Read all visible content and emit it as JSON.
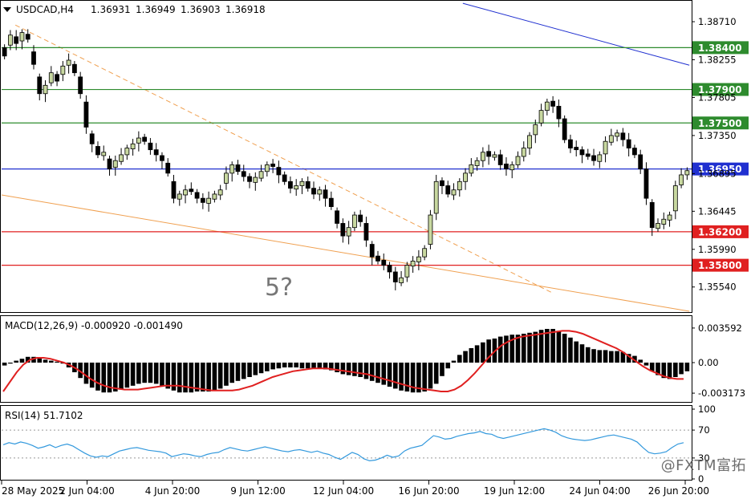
{
  "header": {
    "symbol_timeframe": "USDCAD,H4",
    "open": "1.36931",
    "high": "1.36949",
    "low": "1.36903",
    "close": "1.36918"
  },
  "annotation": "5?",
  "watermark": "@FXTM富拓",
  "colors": {
    "bull_body": "#c8d8a0",
    "bear_body": "#000000",
    "wick": "#000000",
    "resistance": "#2e8b2e",
    "support": "#e02020",
    "current": "#2030d0",
    "trend_blue": "#2030d0",
    "trend_orange": "#f0a050",
    "macd_hist": "#000000",
    "macd_signal": "#e02020",
    "rsi_line": "#3399dd"
  },
  "chart_data": [
    {
      "type": "candlestick",
      "panel": "price",
      "x_tick_labels": [
        "28 May 2025",
        "2 Jun 04:00",
        "4 Jun 20:00",
        "9 Jun 12:00",
        "12 Jun 04:00",
        "16 Jun 20:00",
        "19 Jun 12:00",
        "24 Jun 04:00",
        "26 Jun 20:00"
      ],
      "y_ticks": [
        "1.38710",
        "1.38255",
        "1.37805",
        "1.37350",
        "1.36895",
        "1.36445",
        "1.35990",
        "1.35540"
      ],
      "ylim": [
        1.3525,
        1.3895
      ],
      "levels": [
        {
          "label": "1.38400",
          "value": 1.384,
          "kind": "resistance"
        },
        {
          "label": "1.37900",
          "value": 1.379,
          "kind": "resistance"
        },
        {
          "label": "1.37500",
          "value": 1.375,
          "kind": "resistance"
        },
        {
          "label": "1.36950",
          "value": 1.3695,
          "kind": "current"
        },
        {
          "label": "1.36200",
          "value": 1.362,
          "kind": "support"
        },
        {
          "label": "1.35800",
          "value": 1.358,
          "kind": "support"
        }
      ],
      "trendlines": [
        {
          "color": "trend_blue",
          "style": "solid",
          "from": [
            0.67,
            1.3893
          ],
          "to": [
            0.999,
            1.3819
          ]
        },
        {
          "color": "trend_orange",
          "style": "dashed",
          "from": [
            0.02,
            1.3867
          ],
          "to": [
            0.8,
            1.3547
          ]
        },
        {
          "color": "trend_orange",
          "style": "solid",
          "from": [
            0.0,
            1.3664
          ],
          "to": [
            0.999,
            1.3525
          ]
        }
      ],
      "candles_close": [
        1.383,
        1.3855,
        1.3845,
        1.3858,
        1.385,
        1.382,
        1.3785,
        1.3795,
        1.381,
        1.38,
        1.3818,
        1.3825,
        1.381,
        1.3785,
        1.3745,
        1.3725,
        1.3712,
        1.3715,
        1.3695,
        1.3705,
        1.3712,
        1.372,
        1.3725,
        1.3732,
        1.3728,
        1.3718,
        1.3712,
        1.3705,
        1.369,
        1.366,
        1.3665,
        1.367,
        1.3668,
        1.366,
        1.3655,
        1.366,
        1.3665,
        1.367,
        1.369,
        1.37,
        1.3692,
        1.3686,
        1.368,
        1.3685,
        1.3692,
        1.37,
        1.3698,
        1.3688,
        1.368,
        1.3672,
        1.3675,
        1.368,
        1.3672,
        1.3665,
        1.367,
        1.366,
        1.365,
        1.363,
        1.3615,
        1.3625,
        1.364,
        1.3632,
        1.361,
        1.359,
        1.3585,
        1.358,
        1.3572,
        1.356,
        1.3565,
        1.358,
        1.3585,
        1.359,
        1.36,
        1.364,
        1.368,
        1.3675,
        1.3665,
        1.367,
        1.368,
        1.369,
        1.37,
        1.3705,
        1.3715,
        1.371,
        1.3712,
        1.37,
        1.3695,
        1.37,
        1.371,
        1.372,
        1.3735,
        1.3748,
        1.3765,
        1.3775,
        1.377,
        1.3755,
        1.373,
        1.372,
        1.3718,
        1.3712,
        1.371,
        1.3705,
        1.3712,
        1.3728,
        1.3735,
        1.3738,
        1.373,
        1.372,
        1.3712,
        1.3695,
        1.366,
        1.3625,
        1.363,
        1.3635,
        1.364,
        1.3675,
        1.3688,
        1.3693
      ],
      "candles_open_offset": [
        -0.001,
        0.0012,
        -0.0008,
        0.001,
        -0.0006,
        -0.0015,
        -0.002,
        0.001,
        0.0012,
        -0.0008,
        0.001,
        0.0006,
        -0.001,
        -0.002,
        -0.003,
        -0.0012,
        -0.001,
        0.0004,
        -0.0012,
        0.0008,
        0.0008,
        0.0008,
        0.0006,
        0.0006,
        -0.0005,
        -0.0008,
        -0.0006,
        -0.0006,
        -0.0012,
        -0.002,
        0.0006,
        0.0006,
        -0.0003,
        -0.0007,
        -0.0005,
        0.0006,
        0.0006,
        0.0006,
        0.0012,
        0.001,
        -0.0008,
        -0.0006,
        -0.0006,
        0.0006,
        0.0008,
        0.0008,
        -0.0003,
        -0.0009,
        -0.0008,
        -0.0008,
        0.0004,
        0.0005,
        -0.0008,
        -0.0007,
        0.0005,
        -0.001,
        -0.001,
        -0.0015,
        -0.0015,
        0.001,
        0.0015,
        -0.0008,
        -0.002,
        -0.0015,
        -0.0006,
        -0.0006,
        -0.0008,
        -0.0012,
        0.0006,
        0.0014,
        0.0006,
        0.0006,
        0.001,
        0.0035,
        0.0038,
        -0.0006,
        -0.001,
        0.0006,
        0.001,
        0.001,
        0.001,
        0.0006,
        0.001,
        -0.0006,
        0.0003,
        -0.0012,
        -0.0006,
        0.0006,
        0.001,
        0.001,
        0.0015,
        0.0012,
        0.0015,
        0.001,
        -0.0006,
        -0.0015,
        -0.0025,
        -0.001,
        -0.0003,
        -0.0006,
        -0.0003,
        -0.0006,
        0.0008,
        0.0015,
        0.0008,
        0.0004,
        -0.0008,
        -0.001,
        -0.0008,
        -0.0017,
        -0.0035,
        -0.003,
        0.0006,
        0.0006,
        0.0006,
        0.003,
        0.0012,
        0.0005
      ]
    },
    {
      "type": "bar",
      "panel": "macd",
      "indicator_label": "MACD(12,26,9) -0.000920 -0.001490",
      "y_ticks": [
        "0.003592",
        "0.00",
        "-0.003173"
      ],
      "ylim": [
        -0.004,
        0.0045
      ],
      "histogram": [
        -0.0003,
        -0.0001,
        0.0002,
        0.0004,
        0.0006,
        0.0006,
        0.0005,
        0.0003,
        0.0002,
        0.0001,
        -0.0001,
        -0.0005,
        -0.001,
        -0.0016,
        -0.0022,
        -0.0026,
        -0.0029,
        -0.0031,
        -0.0031,
        -0.003,
        -0.0028,
        -0.0026,
        -0.0024,
        -0.0022,
        -0.0021,
        -0.0021,
        -0.0022,
        -0.0024,
        -0.0027,
        -0.0029,
        -0.0031,
        -0.0031,
        -0.0031,
        -0.003,
        -0.003,
        -0.003,
        -0.0029,
        -0.0027,
        -0.0024,
        -0.0021,
        -0.0019,
        -0.0017,
        -0.0015,
        -0.0013,
        -0.0011,
        -0.0009,
        -0.0007,
        -0.0006,
        -0.0005,
        -0.0005,
        -0.0005,
        -0.0006,
        -0.0006,
        -0.0006,
        -0.0006,
        -0.0007,
        -0.0008,
        -0.001,
        -0.0012,
        -0.0013,
        -0.0014,
        -0.0015,
        -0.0017,
        -0.0019,
        -0.0021,
        -0.0023,
        -0.0025,
        -0.0027,
        -0.0029,
        -0.003,
        -0.0031,
        -0.0031,
        -0.003,
        -0.0027,
        -0.0022,
        -0.0014,
        -0.0006,
        0.0002,
        0.0008,
        0.0012,
        0.0015,
        0.0018,
        0.0021,
        0.0024,
        0.0025,
        0.0027,
        0.0028,
        0.0029,
        0.0029,
        0.003,
        0.0031,
        0.0032,
        0.0034,
        0.0035,
        0.0035,
        0.0033,
        0.003,
        0.0026,
        0.0022,
        0.0019,
        0.0016,
        0.0014,
        0.0013,
        0.0013,
        0.0012,
        0.0012,
        0.0011,
        0.0009,
        0.0007,
        0.0003,
        -0.0003,
        -0.0009,
        -0.0013,
        -0.0016,
        -0.0017,
        -0.0015,
        -0.0012,
        -0.0009
      ],
      "signal": [
        -0.003,
        -0.002,
        -0.001,
        -0.0002,
        0.0003,
        0.0005,
        0.0005,
        0.0004,
        0.0002,
        0.0,
        -0.0003,
        -0.0007,
        -0.0012,
        -0.0017,
        -0.0021,
        -0.0024,
        -0.0026,
        -0.0027,
        -0.0028,
        -0.0028,
        -0.0028,
        -0.0027,
        -0.0026,
        -0.0025,
        -0.0024,
        -0.0024,
        -0.0024,
        -0.0025,
        -0.0026,
        -0.0027,
        -0.0028,
        -0.0029,
        -0.0029,
        -0.0029,
        -0.0029,
        -0.0028,
        -0.0026,
        -0.0024,
        -0.0021,
        -0.0018,
        -0.0015,
        -0.0013,
        -0.0011,
        -0.0009,
        -0.0008,
        -0.0007,
        -0.0006,
        -0.0006,
        -0.0006,
        -0.0007,
        -0.0008,
        -0.0009,
        -0.001,
        -0.0011,
        -0.0012,
        -0.0014,
        -0.0016,
        -0.0018,
        -0.002,
        -0.0022,
        -0.0024,
        -0.0026,
        -0.0027,
        -0.0028,
        -0.0029,
        -0.003,
        -0.003,
        -0.0028,
        -0.0024,
        -0.0018,
        -0.0011,
        -0.0003,
        0.0005,
        0.0012,
        0.0018,
        0.0022,
        0.0025,
        0.0027,
        0.0028,
        0.0029,
        0.003,
        0.0031,
        0.0032,
        0.0033,
        0.0033,
        0.0032,
        0.003,
        0.0027,
        0.0024,
        0.0021,
        0.0018,
        0.0015,
        0.0011,
        0.0006,
        0.0001,
        -0.0004,
        -0.0008,
        -0.0011,
        -0.0014,
        -0.0016,
        -0.0017,
        -0.0017
      ]
    },
    {
      "type": "line",
      "panel": "rsi",
      "indicator_label": "RSI(14) 51.7102",
      "y_ticks": [
        "100",
        "70",
        "30",
        "0"
      ],
      "ylim": [
        0,
        100
      ],
      "levels": [
        70,
        30
      ],
      "values": [
        49,
        52,
        50,
        53,
        51,
        48,
        44,
        46,
        49,
        45,
        48,
        50,
        47,
        42,
        37,
        33,
        31,
        33,
        32,
        36,
        40,
        42,
        44,
        45,
        43,
        41,
        40,
        39,
        37,
        32,
        34,
        36,
        35,
        33,
        32,
        35,
        37,
        38,
        42,
        45,
        43,
        41,
        40,
        42,
        44,
        46,
        44,
        42,
        40,
        39,
        41,
        42,
        40,
        38,
        40,
        37,
        35,
        31,
        28,
        33,
        38,
        35,
        29,
        26,
        27,
        30,
        34,
        31,
        33,
        40,
        44,
        46,
        48,
        55,
        62,
        60,
        57,
        58,
        61,
        63,
        65,
        66,
        68,
        65,
        64,
        60,
        58,
        60,
        62,
        64,
        66,
        68,
        70,
        72,
        70,
        67,
        62,
        59,
        57,
        56,
        55,
        56,
        58,
        60,
        62,
        63,
        61,
        59,
        57,
        53,
        45,
        38,
        36,
        37,
        39,
        45,
        50,
        52
      ]
    }
  ]
}
